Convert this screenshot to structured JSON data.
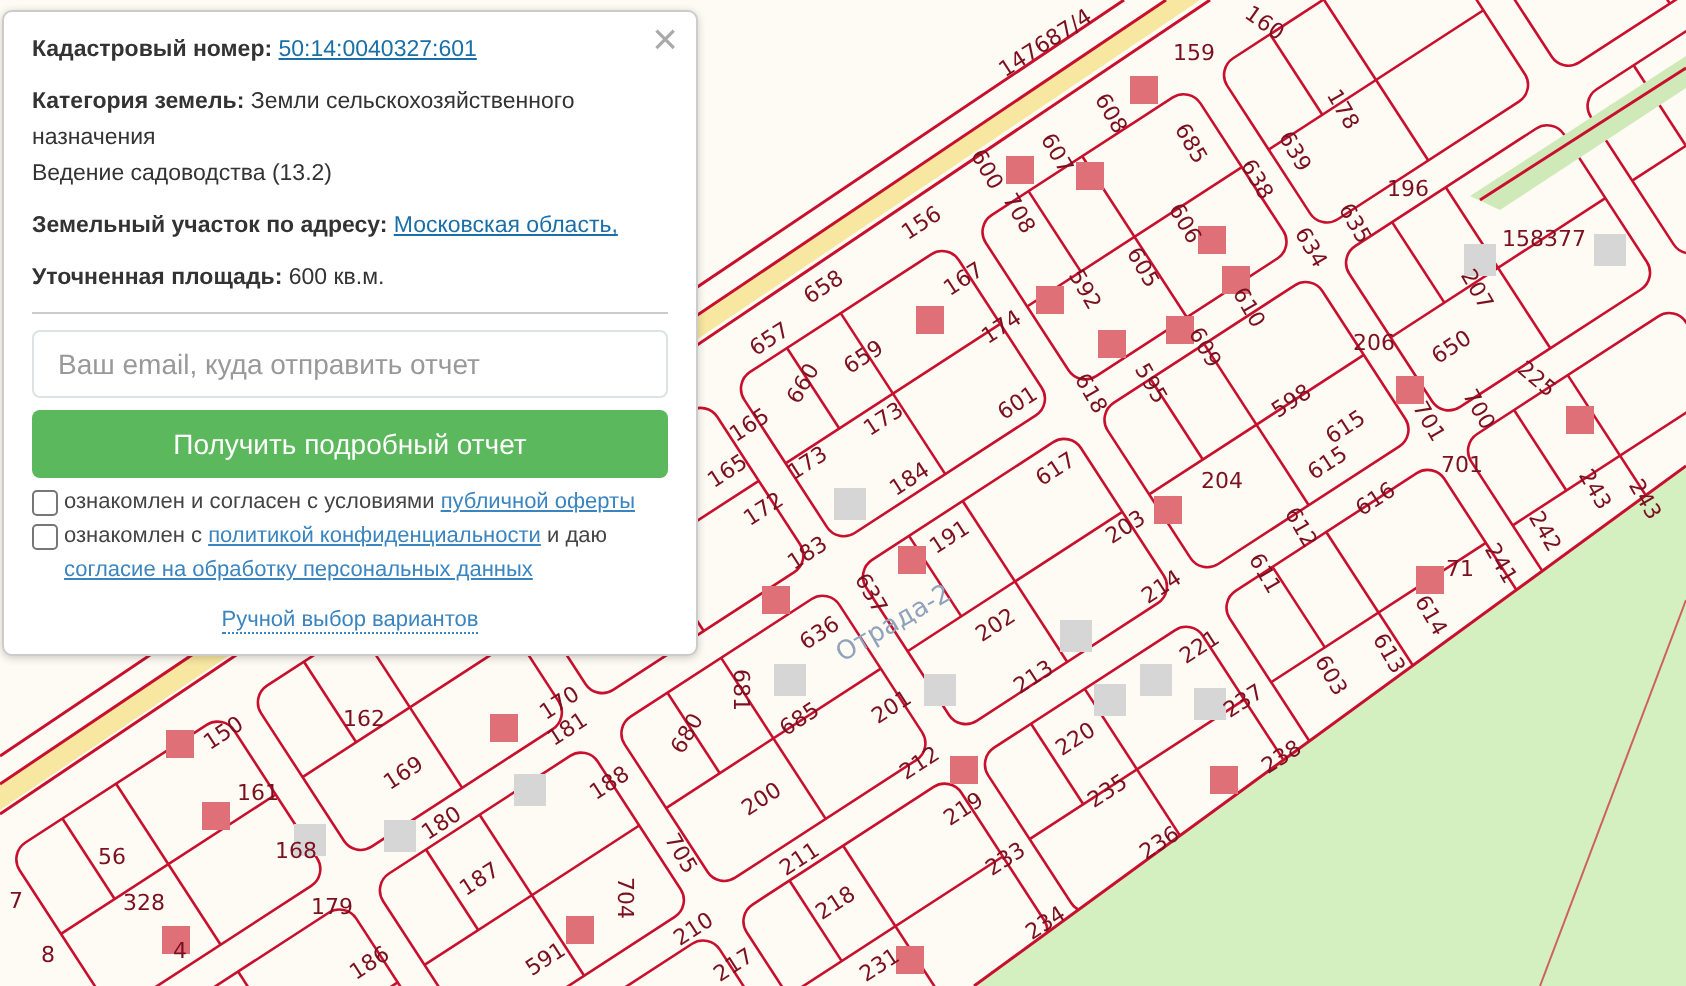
{
  "map": {
    "parcel_numbers": [
      "147687/4",
      "159",
      "160",
      "178",
      "608",
      "607",
      "600",
      "708",
      "685",
      "638",
      "639",
      "196",
      "635",
      "634",
      "156",
      "158377",
      "606",
      "605",
      "592",
      "167",
      "658",
      "610",
      "207",
      "657",
      "174",
      "609",
      "595",
      "206",
      "650",
      "659",
      "660",
      "225",
      "173",
      "173",
      "618",
      "601",
      "598",
      "615",
      "615",
      "165",
      "165",
      "700",
      "701",
      "701",
      "617",
      "204",
      "184",
      "172",
      "616",
      "243",
      "243",
      "612",
      "203",
      "183",
      "191",
      "242",
      "611",
      "214",
      "241",
      "71",
      "637",
      "636",
      "202",
      "614",
      "221",
      "613",
      "603",
      "681",
      "680",
      "201",
      "213",
      "237",
      "685",
      "212",
      "220",
      "238",
      "200",
      "235",
      "219",
      "211",
      "236",
      "233",
      "218",
      "234",
      "231",
      "217",
      "210",
      "705",
      "704",
      "170",
      "150",
      "162",
      "161",
      "169",
      "181",
      "188",
      "168",
      "180",
      "56",
      "7",
      "328",
      "179",
      "187",
      "8",
      "4",
      "186",
      "591"
    ],
    "street_label": "Отрада-2"
  },
  "popup": {
    "close": "×",
    "cadastral": {
      "label": "Кадастровый номер:",
      "value": "50:14:0040327:601"
    },
    "category": {
      "label": "Категория земель:",
      "value": "Земли сельскохозяйственного назначения"
    },
    "use": "Ведение садоводства (13.2)",
    "address": {
      "label": "Земельный участок по адресу:",
      "value": "Московская область,"
    },
    "area": {
      "label": "Уточненная площадь:",
      "value": "600 кв.м."
    },
    "email": {
      "placeholder": "Ваш email, куда отправить отчет"
    },
    "submit": "Получить подробный отчет",
    "agreements": [
      {
        "checked": false,
        "parts": [
          {
            "kind": "text",
            "text": "ознакомлен и согласен с условиями "
          },
          {
            "kind": "link",
            "text": "публичной оферты"
          }
        ]
      },
      {
        "checked": false,
        "parts": [
          {
            "kind": "text",
            "text": "ознакомлен с "
          },
          {
            "kind": "link",
            "text": "политикой конфиденциальности"
          },
          {
            "kind": "text",
            "text": " и даю "
          },
          {
            "kind": "link",
            "text": "согласие на обработку персональных данных"
          }
        ]
      }
    ],
    "manual": "Ручной выбор вариантов"
  }
}
